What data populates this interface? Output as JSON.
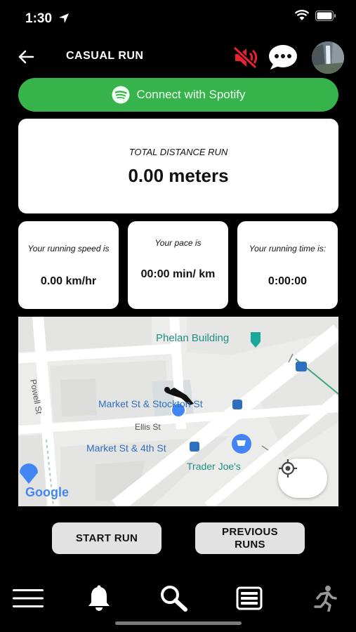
{
  "status_bar": {
    "time": "1:30"
  },
  "header": {
    "title": "CASUAL RUN",
    "back_icon": "arrow-left-icon",
    "mute_icon": "volume-mute-icon",
    "chat_icon": "chat-bubble-icon"
  },
  "spotify": {
    "label": "Connect with Spotify",
    "icon": "spotify-icon",
    "color": "#36b34a"
  },
  "distance": {
    "label": "TOTAL DISTANCE RUN",
    "value": "0.00 meters"
  },
  "stats": [
    {
      "label": "Your running speed is",
      "value": "0.00 km/hr"
    },
    {
      "label": "Your pace is",
      "value": "00:00 min/ km"
    },
    {
      "label": "Your running time is:",
      "value": "0:00:00"
    }
  ],
  "map": {
    "labels": {
      "phelan": "Phelan Building",
      "market_stockton": "Market St & Stockton St",
      "ellis": "Ellis St",
      "market_4th": "Market St & 4th St",
      "trader_joes": "Trader Joe's",
      "powell": "Powell St"
    },
    "logo": "Google"
  },
  "actions": {
    "start": "START RUN",
    "previous": "PREVIOUS RUNS"
  },
  "nav": [
    "menu-icon",
    "bell-icon",
    "search-icon",
    "list-icon",
    "runner-icon"
  ]
}
